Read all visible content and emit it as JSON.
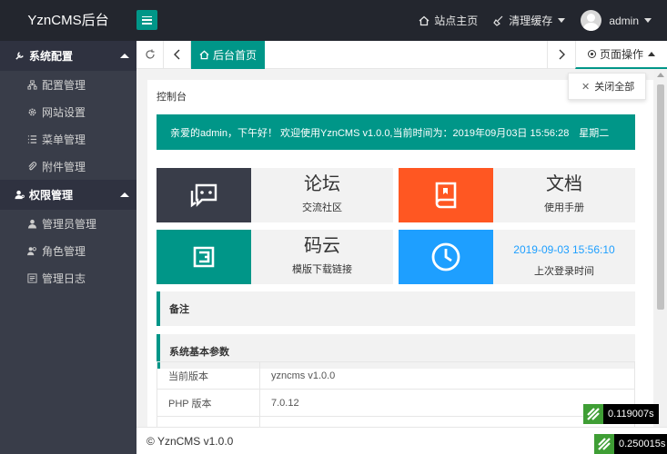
{
  "header": {
    "logo": "YznCMS后台",
    "site_home": "站点主页",
    "clear_cache": "清理缓存",
    "user": "admin"
  },
  "sidebar": {
    "groups": [
      {
        "label": "系统配置",
        "icon": "wrench-icon",
        "items": [
          {
            "label": "配置管理",
            "icon": "sitemap-icon"
          },
          {
            "label": "网站设置",
            "icon": "gear-icon"
          },
          {
            "label": "菜单管理",
            "icon": "list-icon"
          },
          {
            "label": "附件管理",
            "icon": "paperclip-icon"
          }
        ]
      },
      {
        "label": "权限管理",
        "icon": "user-key-icon",
        "items": [
          {
            "label": "管理员管理",
            "icon": "user-icon"
          },
          {
            "label": "角色管理",
            "icon": "users-icon"
          },
          {
            "label": "管理日志",
            "icon": "log-icon"
          }
        ]
      }
    ]
  },
  "tabs": {
    "home": "后台首页",
    "page_ops": "页面操作",
    "close_all": "关闭全部"
  },
  "content": {
    "title": "控制台",
    "welcome": "亲爱的admin，下午好！ 欢迎使用YznCMS v1.0.0,当前时间为：2019年09月03日 15:56:28　星期二",
    "tiles": [
      {
        "big": "论坛",
        "small": "交流社区",
        "color": "#393d49",
        "icon": "chat-icon"
      },
      {
        "big": "文档",
        "small": "使用手册",
        "color": "#ff5722",
        "icon": "book-icon"
      },
      {
        "big": "码云",
        "small": "模版下载链接",
        "color": "#009688",
        "icon": "gitee-icon"
      },
      {
        "big": "2019-09-03 15:56:10",
        "small": "上次登录时间",
        "color": "#1e9fff",
        "icon": "clock-icon"
      }
    ],
    "sections": {
      "notes": "备注",
      "params": "系统基本参数"
    },
    "params": [
      {
        "key": "当前版本",
        "value": "yzncms v1.0.0"
      },
      {
        "key": "PHP 版本",
        "value": "7.0.12"
      },
      {
        "key": "",
        "value": ""
      }
    ]
  },
  "footer": "© YznCMS v1.0.0",
  "timings": [
    "0.119007s",
    "0.250015s"
  ],
  "colors": {
    "accent": "#009688",
    "header_bg": "#23262e",
    "sidebar_bg": "#393d49",
    "blue": "#1e9fff",
    "orange": "#ff5722"
  }
}
